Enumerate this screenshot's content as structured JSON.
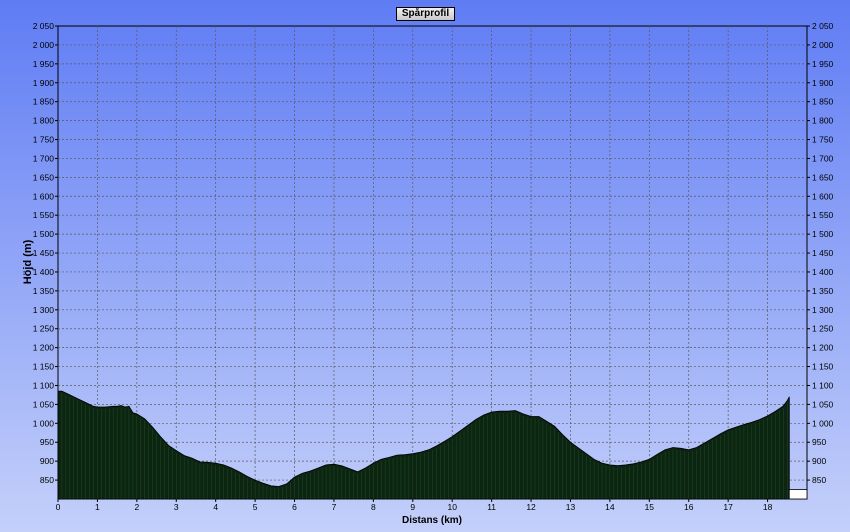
{
  "chart_data": {
    "type": "area",
    "title": "Spårprofil",
    "xlabel": "Distans (km)",
    "ylabel": "Höjd (m)",
    "xlim": [
      0,
      19
    ],
    "ylim": [
      800,
      2050
    ],
    "x_ticks": [
      "0",
      "1",
      "2",
      "3",
      "4",
      "5",
      "6",
      "7",
      "8",
      "9",
      "10",
      "11",
      "12",
      "13",
      "14",
      "15",
      "16",
      "17",
      "18"
    ],
    "y_ticks": [
      "850",
      "900",
      "950",
      "1 000",
      "1 050",
      "1 100",
      "1 150",
      "1 200",
      "1 250",
      "1 300",
      "1 350",
      "1 400",
      "1 450",
      "1 500",
      "1 550",
      "1 600",
      "1 650",
      "1 700",
      "1 750",
      "1 800",
      "1 850",
      "1 900",
      "1 950",
      "2 000",
      "2 050"
    ],
    "grid": true,
    "colors": {
      "fill": "#0d2412",
      "stripe": "#1f7a2a",
      "background_top": "#5f7cf4",
      "background_bottom": "#c4d0fa",
      "grid": "#5a5a5a"
    },
    "series": [
      {
        "x": [
          0,
          0.1,
          0.3,
          0.5,
          0.7,
          0.9,
          1.0,
          1.2,
          1.4,
          1.5,
          1.6,
          1.7,
          1.8,
          1.9,
          2.0,
          2.2,
          2.4,
          2.6,
          2.8,
          3.0,
          3.2,
          3.4,
          3.6,
          3.8,
          4.0,
          4.2,
          4.4,
          4.6,
          4.8,
          5.0,
          5.2,
          5.4,
          5.6,
          5.8,
          6.0,
          6.2,
          6.4,
          6.6,
          6.8,
          7.0,
          7.2,
          7.4,
          7.6,
          7.8,
          8.0,
          8.2,
          8.4,
          8.6,
          8.8,
          9.0,
          9.2,
          9.4,
          9.6,
          9.8,
          10.0,
          10.2,
          10.4,
          10.6,
          10.8,
          11.0,
          11.2,
          11.4,
          11.6,
          11.8,
          12.0,
          12.2,
          12.4,
          12.6,
          12.8,
          13.0,
          13.2,
          13.4,
          13.6,
          13.8,
          14.0,
          14.2,
          14.4,
          14.6,
          14.8,
          15.0,
          15.2,
          15.4,
          15.6,
          15.8,
          16.0,
          16.2,
          16.4,
          16.6,
          16.8,
          17.0,
          17.2,
          17.4,
          17.6,
          17.8,
          18.0,
          18.2,
          18.4,
          18.5,
          18.55
        ],
        "y": [
          1085,
          1085,
          1075,
          1065,
          1055,
          1045,
          1043,
          1043,
          1045,
          1045,
          1047,
          1043,
          1045,
          1028,
          1025,
          1012,
          990,
          965,
          942,
          928,
          915,
          908,
          898,
          897,
          895,
          890,
          882,
          872,
          860,
          850,
          842,
          835,
          833,
          840,
          858,
          868,
          874,
          882,
          890,
          892,
          888,
          880,
          872,
          882,
          895,
          905,
          910,
          916,
          917,
          920,
          924,
          930,
          940,
          952,
          965,
          980,
          995,
          1010,
          1022,
          1030,
          1032,
          1032,
          1034,
          1025,
          1018,
          1018,
          1005,
          992,
          970,
          950,
          935,
          920,
          905,
          895,
          890,
          888,
          890,
          893,
          898,
          905,
          918,
          930,
          936,
          934,
          930,
          936,
          948,
          960,
          972,
          983,
          990,
          997,
          1003,
          1010,
          1020,
          1032,
          1046,
          1060,
          1070
        ]
      }
    ]
  }
}
